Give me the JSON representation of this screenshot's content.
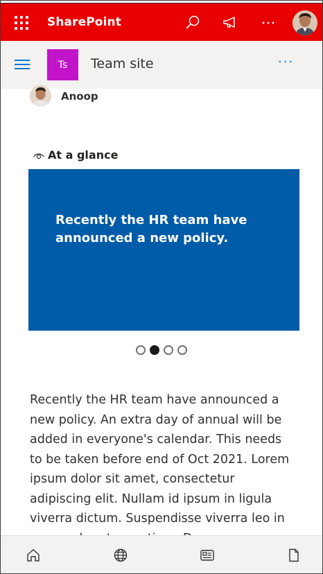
{
  "suitebar": {
    "brand": "SharePoint",
    "icons": [
      "waffle-icon",
      "search-icon",
      "megaphone-icon",
      "more-icon",
      "profile-avatar"
    ]
  },
  "site_header": {
    "logo_text": "Ts",
    "title": "Team site",
    "more": "···"
  },
  "author": {
    "name": "Anoop"
  },
  "section": {
    "title": "At a glance",
    "icon": "eye-icon"
  },
  "carousel": {
    "slide_text": "Recently the HR team have announced a new policy.",
    "slide_count": 4,
    "active_index": 1
  },
  "body": {
    "text": "Recently the HR team have announced a new policy. An extra day of annual will be added in everyone's calendar. This needs to be taken before end of Oct 2021. Lorem ipsum dolor sit amet, consectetur adipiscing elit. Nullam id ipsum in ligula viverra dictum. Suspendisse viverra leo in augue pharetra pretium. Donec eu nunc"
  },
  "bottom_nav": {
    "items": [
      "home-icon",
      "globe-icon",
      "news-icon",
      "file-icon"
    ]
  },
  "colors": {
    "suitebar": "#e80000",
    "site_logo": "#c114c8",
    "hero": "#005ba8",
    "accent": "#0078d4"
  }
}
